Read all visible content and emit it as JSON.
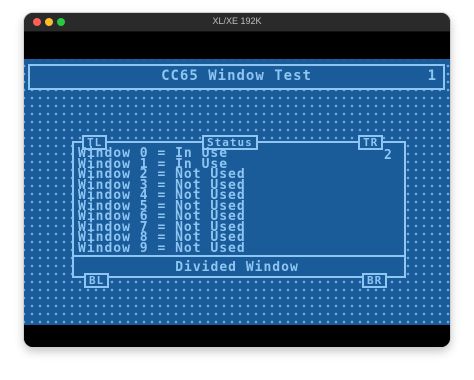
{
  "window": {
    "title": "XL/XE 192K"
  },
  "header": {
    "title": "CC65 Window Test",
    "number": "1"
  },
  "panel": {
    "tab_tl": "TL",
    "tab_status": "Status",
    "tab_tr": "TR",
    "tab_bl": "BL",
    "tab_br": "BR",
    "number": "2",
    "footer": "Divided Window",
    "rows": [
      "Window 0 = In Use",
      "Window 1 = In Use",
      "Window 2 = Not Used",
      "Window 3 = Not Used",
      "Window 4 = Not Used",
      "Window 5 = Not Used",
      "Window 6 = Not Used",
      "Window 7 = Not Used",
      "Window 8 = Not Used",
      "Window 9 = Not Used"
    ]
  },
  "colors": {
    "screen": "#1a5c9a",
    "foreground": "#8ec5f2",
    "dots": "#6fa8dc"
  }
}
